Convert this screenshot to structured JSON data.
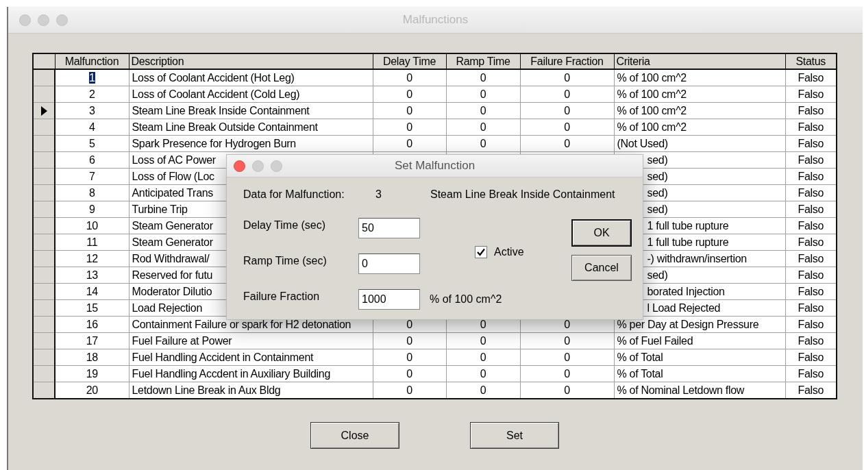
{
  "window": {
    "title": "Malfunctions",
    "controls": [
      {
        "active": false
      },
      {
        "active": false
      },
      {
        "active": false
      }
    ]
  },
  "table": {
    "columns": [
      "Malfunction",
      "Description",
      "Delay Time",
      "Ramp Time",
      "Failure Fraction",
      "Criteria",
      "Status"
    ],
    "rows": [
      {
        "selected": false,
        "focused": true,
        "covered": false,
        "malfunction": "1",
        "description": "Loss of Coolant Accident (Hot Leg)",
        "delay_time": "0",
        "ramp_time": "0",
        "failure_fraction": "0",
        "criteria": "% of 100 cm^2",
        "status": "Falso"
      },
      {
        "selected": false,
        "focused": false,
        "covered": false,
        "malfunction": "2",
        "description": "Loss of Coolant Accident (Cold Leg)",
        "delay_time": "0",
        "ramp_time": "0",
        "failure_fraction": "0",
        "criteria": "% of 100 cm^2",
        "status": "Falso"
      },
      {
        "selected": true,
        "focused": false,
        "covered": false,
        "malfunction": "3",
        "description": "Steam Line Break Inside Containment",
        "delay_time": "0",
        "ramp_time": "0",
        "failure_fraction": "0",
        "criteria": "% of 100 cm^2",
        "status": "Falso"
      },
      {
        "selected": false,
        "focused": false,
        "covered": false,
        "malfunction": "4",
        "description": "Steam Line Break Outside Containment",
        "delay_time": "0",
        "ramp_time": "0",
        "failure_fraction": "0",
        "criteria": "% of 100 cm^2",
        "status": "Falso"
      },
      {
        "selected": false,
        "focused": false,
        "covered": false,
        "malfunction": "5",
        "description": "Spark Presence for Hydrogen Burn",
        "delay_time": "0",
        "ramp_time": "0",
        "failure_fraction": "0",
        "criteria": "(Not Used)",
        "status": "Falso"
      },
      {
        "selected": false,
        "focused": false,
        "covered": true,
        "malfunction": "6",
        "description": "Loss of AC Power",
        "criteria": "sed)",
        "status": "Falso"
      },
      {
        "selected": false,
        "focused": false,
        "covered": true,
        "malfunction": "7",
        "description": "Loss of Flow (Loc",
        "criteria": "sed)",
        "status": "Falso"
      },
      {
        "selected": false,
        "focused": false,
        "covered": true,
        "malfunction": "8",
        "description": "Anticipated Trans",
        "criteria": "sed)",
        "status": "Falso"
      },
      {
        "selected": false,
        "focused": false,
        "covered": true,
        "malfunction": "9",
        "description": "Turbine Trip",
        "criteria": "sed)",
        "status": "Falso"
      },
      {
        "selected": false,
        "focused": false,
        "covered": true,
        "malfunction": "10",
        "description": "Steam Generator",
        "criteria": "1 full tube rupture",
        "status": "Falso"
      },
      {
        "selected": false,
        "focused": false,
        "covered": true,
        "malfunction": "11",
        "description": "Steam Generator",
        "criteria": "1 full tube rupture",
        "status": "Falso"
      },
      {
        "selected": false,
        "focused": false,
        "covered": true,
        "malfunction": "12",
        "description": "Rod Withdrawal/",
        "criteria": "-) withdrawn/insertion",
        "status": "Falso"
      },
      {
        "selected": false,
        "focused": false,
        "covered": true,
        "malfunction": "13",
        "description": "Reserved for futu",
        "criteria": "sed)",
        "status": "Falso"
      },
      {
        "selected": false,
        "focused": false,
        "covered": true,
        "malfunction": "14",
        "description": "Moderator Dilutio",
        "criteria": "borated Injection",
        "status": "Falso"
      },
      {
        "selected": false,
        "focused": false,
        "covered": true,
        "malfunction": "15",
        "description": "Load Rejection",
        "criteria": "l Load Rejected",
        "status": "Falso"
      },
      {
        "selected": false,
        "focused": false,
        "covered": false,
        "malfunction": "16",
        "description": "Containment Failure or spark for H2 detonation",
        "delay_time": "0",
        "ramp_time": "0",
        "failure_fraction": "0",
        "criteria": "% per Day at Design Pressure",
        "status": "Falso"
      },
      {
        "selected": false,
        "focused": false,
        "covered": false,
        "malfunction": "17",
        "description": "Fuel Failure at Power",
        "delay_time": "0",
        "ramp_time": "0",
        "failure_fraction": "0",
        "criteria": "% of Fuel Failed",
        "status": "Falso"
      },
      {
        "selected": false,
        "focused": false,
        "covered": false,
        "malfunction": "18",
        "description": "Fuel Handling Accident in Containment",
        "delay_time": "0",
        "ramp_time": "0",
        "failure_fraction": "0",
        "criteria": "% of Total",
        "status": "Falso"
      },
      {
        "selected": false,
        "focused": false,
        "covered": false,
        "malfunction": "19",
        "description": "Fuel Handling Accdent in Auxiliary Building",
        "delay_time": "0",
        "ramp_time": "0",
        "failure_fraction": "0",
        "criteria": "% of Total",
        "status": "Falso"
      },
      {
        "selected": false,
        "focused": false,
        "covered": false,
        "malfunction": "20",
        "description": "Letdown Line Break in Aux Bldg",
        "delay_time": "0",
        "ramp_time": "0",
        "failure_fraction": "0",
        "criteria": "% of Nominal Letdown flow",
        "status": "Falso"
      }
    ]
  },
  "buttons": [
    "Close",
    "Set"
  ],
  "dialog": {
    "title": "Set Malfunction",
    "controls": [
      {
        "active": true
      },
      {
        "active": false
      },
      {
        "active": false
      }
    ],
    "data_label": "Data for Malfunction:",
    "data_number": "3",
    "data_description": "Steam Line Break Inside Containment",
    "fields": [
      {
        "label": "Delay Time (sec)",
        "value": "50"
      },
      {
        "label": "Ramp Time (sec)",
        "value": "0"
      },
      {
        "label": "Failure Fraction",
        "value": "1000",
        "unit": "% of 100 cm^2"
      }
    ],
    "active": {
      "label": "Active",
      "checked": true
    },
    "buttons": [
      {
        "label": "OK",
        "default": true
      },
      {
        "label": "Cancel",
        "default": false
      }
    ]
  }
}
